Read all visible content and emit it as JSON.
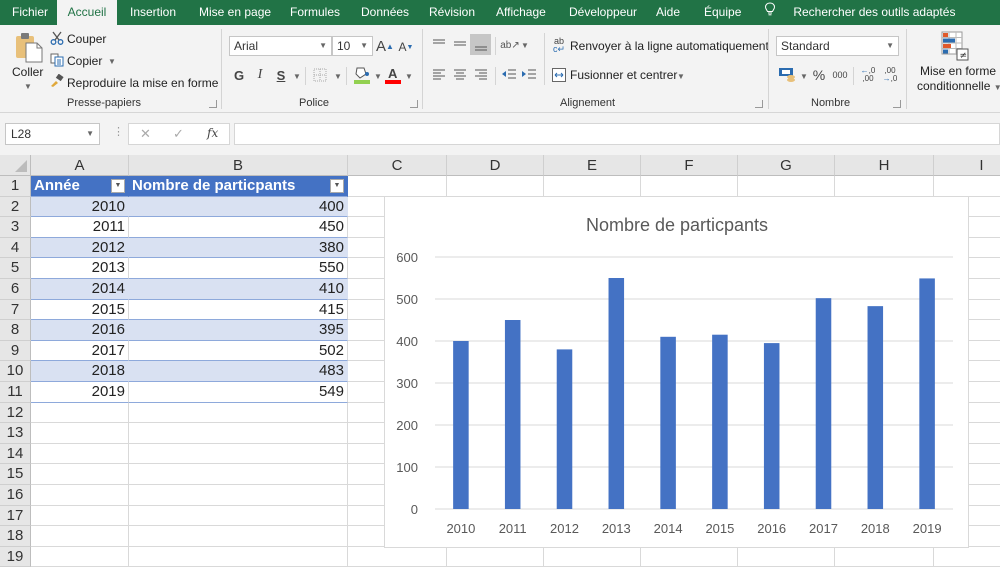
{
  "tabs": [
    {
      "label": "Fichier",
      "active": false
    },
    {
      "label": "Accueil",
      "active": true
    },
    {
      "label": "Insertion",
      "active": false
    },
    {
      "label": "Mise en page",
      "active": false
    },
    {
      "label": "Formules",
      "active": false
    },
    {
      "label": "Données",
      "active": false
    },
    {
      "label": "Révision",
      "active": false
    },
    {
      "label": "Affichage",
      "active": false
    },
    {
      "label": "Développeur",
      "active": false
    },
    {
      "label": "Aide",
      "active": false
    },
    {
      "label": "Équipe",
      "active": false
    }
  ],
  "search": {
    "label": "Rechercher des outils adaptés",
    "icon": "lightbulb-icon"
  },
  "ribbon": {
    "clipboard": {
      "paste": "Coller",
      "cut": "Couper",
      "copy": "Copier",
      "format_painter": "Reproduire la mise en forme",
      "group": "Presse-papiers"
    },
    "font": {
      "font_name": "Arial",
      "font_size": "10",
      "bold": "G",
      "italic": "I",
      "underline": "S",
      "grow": "A",
      "shrink": "A",
      "font_color_letter": "A",
      "fill_color": "#92d050",
      "text_color": "#ff0000",
      "group": "Police"
    },
    "alignment": {
      "wrap_text": "Renvoyer à la ligne automatiquement",
      "merge_center": "Fusionner et centrer",
      "group": "Alignement"
    },
    "number": {
      "format": "Standard",
      "percent": "%",
      "thousands": "000",
      "inc_decimal": "←,0 ,00",
      "dec_decimal": ",00 →,0",
      "group": "Nombre"
    },
    "styles": {
      "conditional_line1": "Mise en forme",
      "conditional_line2": "conditionnelle"
    }
  },
  "formula_bar": {
    "name_box": "L28",
    "cancel": "✕",
    "enter": "✓",
    "fx": "fx",
    "formula": ""
  },
  "columns": [
    "A",
    "B",
    "C",
    "D",
    "E",
    "F",
    "G",
    "H",
    "I"
  ],
  "rows": [
    "1",
    "2",
    "3",
    "4",
    "5",
    "6",
    "7",
    "8",
    "9",
    "10",
    "11",
    "12",
    "13",
    "14",
    "15",
    "16",
    "17",
    "18",
    "19"
  ],
  "table": {
    "headers": [
      "Année",
      "Nombre de particpants"
    ],
    "rows": [
      [
        "2010",
        "400"
      ],
      [
        "2011",
        "450"
      ],
      [
        "2012",
        "380"
      ],
      [
        "2013",
        "550"
      ],
      [
        "2014",
        "410"
      ],
      [
        "2015",
        "415"
      ],
      [
        "2016",
        "395"
      ],
      [
        "2017",
        "502"
      ],
      [
        "2018",
        "483"
      ],
      [
        "2019",
        "549"
      ]
    ]
  },
  "chart_data": {
    "type": "bar",
    "title": "Nombre de particpants",
    "categories": [
      "2010",
      "2011",
      "2012",
      "2013",
      "2014",
      "2015",
      "2016",
      "2017",
      "2018",
      "2019"
    ],
    "values": [
      400,
      450,
      380,
      550,
      410,
      415,
      395,
      502,
      483,
      549
    ],
    "xlabel": "",
    "ylabel": "",
    "ylim": [
      0,
      600
    ],
    "yticks": [
      0,
      100,
      200,
      300,
      400,
      500,
      600
    ],
    "grid": true,
    "legend": "none",
    "bar_color": "#4472c4"
  }
}
